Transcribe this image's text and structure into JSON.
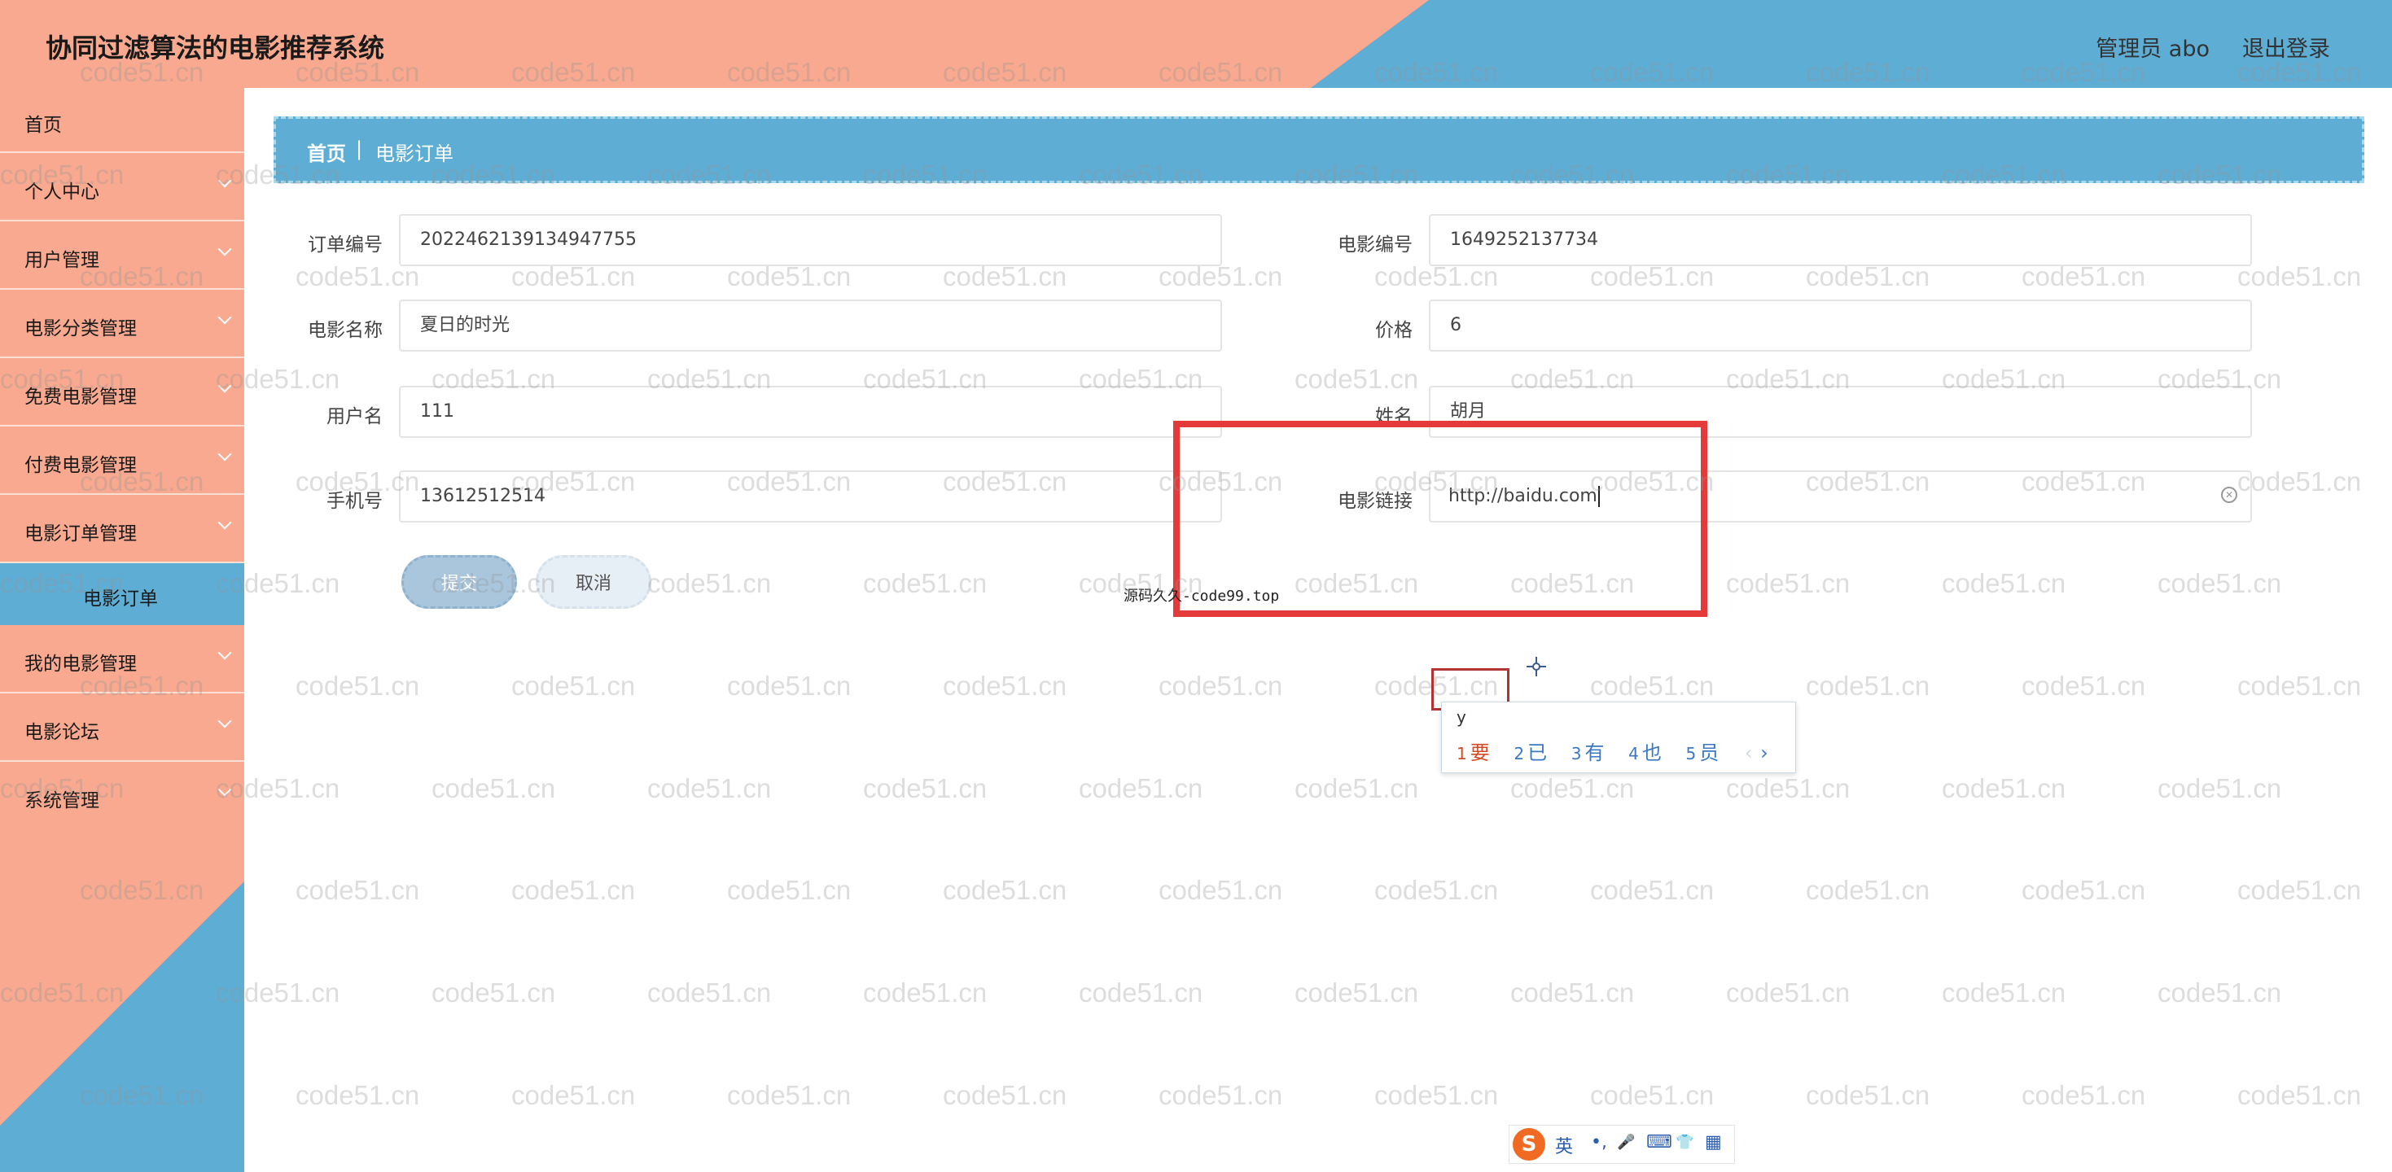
{
  "header": {
    "title": "协同过滤算法的电影推荐系统",
    "user": "管理员 abo",
    "logout": "退出登录"
  },
  "sidebar": {
    "items": [
      {
        "label": "首页",
        "chevron": false
      },
      {
        "label": "个人中心",
        "chevron": true
      },
      {
        "label": "用户管理",
        "chevron": true
      },
      {
        "label": "电影分类管理",
        "chevron": true
      },
      {
        "label": "免费电影管理",
        "chevron": true
      },
      {
        "label": "付费电影管理",
        "chevron": true
      },
      {
        "label": "电影订单管理",
        "chevron": true
      },
      {
        "label": "电影订单",
        "sub": true
      },
      {
        "label": "我的电影管理",
        "chevron": true
      },
      {
        "label": "电影论坛",
        "chevron": true
      },
      {
        "label": "系统管理",
        "chevron": true
      }
    ]
  },
  "breadcrumb": {
    "home": "首页",
    "separator": "|",
    "current": "电影订单"
  },
  "form": {
    "order_no": {
      "label": "订单编号",
      "value": "2022462139134947755"
    },
    "movie_no": {
      "label": "电影编号",
      "value": "1649252137734"
    },
    "movie_name": {
      "label": "电影名称",
      "value": "夏日的时光"
    },
    "price": {
      "label": "价格",
      "value": "6"
    },
    "username": {
      "label": "用户名",
      "value": "111"
    },
    "name": {
      "label": "姓名",
      "value": "胡月"
    },
    "phone": {
      "label": "手机号",
      "value": "13612512514"
    },
    "movie_link": {
      "label": "电影链接",
      "value": "http://baidu.com"
    }
  },
  "buttons": {
    "submit": "提交",
    "cancel": "取消"
  },
  "overlay": {
    "text": "源码久久-code99.top"
  },
  "ime": {
    "input": "y",
    "candidates": [
      {
        "num": "1",
        "text": "要"
      },
      {
        "num": "2",
        "text": "已"
      },
      {
        "num": "3",
        "text": "有"
      },
      {
        "num": "4",
        "text": "也"
      },
      {
        "num": "5",
        "text": "员"
      }
    ],
    "prev": "‹",
    "next": "›",
    "toolbar": {
      "logo": "S",
      "mode": "英",
      "punct": "•,",
      "mic": "🎤",
      "keyboard": "⌨",
      "skin": "👕",
      "apps": "▦"
    }
  },
  "watermark": "code51.cn",
  "colors": {
    "salmon": "#f8a98f",
    "blue": "#5eadd4",
    "annotation": "#e53a3a"
  }
}
